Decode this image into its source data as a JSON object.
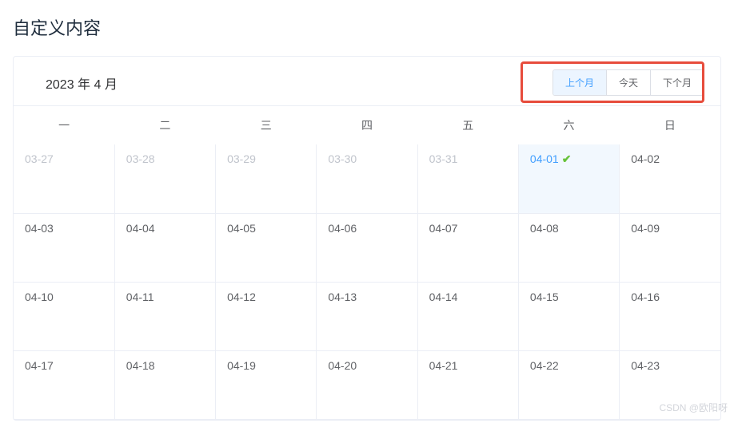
{
  "title": "自定义内容",
  "dateTitle": "2023 年 4 月",
  "buttons": {
    "prev": "上个月",
    "today": "今天",
    "next": "下个月"
  },
  "weekdays": [
    "一",
    "二",
    "三",
    "四",
    "五",
    "六",
    "日"
  ],
  "rows": [
    [
      {
        "label": "03-27",
        "cls": "prev-month"
      },
      {
        "label": "03-28",
        "cls": "prev-month"
      },
      {
        "label": "03-29",
        "cls": "prev-month"
      },
      {
        "label": "03-30",
        "cls": "prev-month"
      },
      {
        "label": "03-31",
        "cls": "prev-month"
      },
      {
        "label": "04-01",
        "cls": "today",
        "check": true
      },
      {
        "label": "04-02",
        "cls": ""
      }
    ],
    [
      {
        "label": "04-03",
        "cls": ""
      },
      {
        "label": "04-04",
        "cls": ""
      },
      {
        "label": "04-05",
        "cls": ""
      },
      {
        "label": "04-06",
        "cls": ""
      },
      {
        "label": "04-07",
        "cls": ""
      },
      {
        "label": "04-08",
        "cls": ""
      },
      {
        "label": "04-09",
        "cls": ""
      }
    ],
    [
      {
        "label": "04-10",
        "cls": ""
      },
      {
        "label": "04-11",
        "cls": ""
      },
      {
        "label": "04-12",
        "cls": ""
      },
      {
        "label": "04-13",
        "cls": ""
      },
      {
        "label": "04-14",
        "cls": ""
      },
      {
        "label": "04-15",
        "cls": ""
      },
      {
        "label": "04-16",
        "cls": ""
      }
    ],
    [
      {
        "label": "04-17",
        "cls": ""
      },
      {
        "label": "04-18",
        "cls": ""
      },
      {
        "label": "04-19",
        "cls": ""
      },
      {
        "label": "04-20",
        "cls": ""
      },
      {
        "label": "04-21",
        "cls": ""
      },
      {
        "label": "04-22",
        "cls": ""
      },
      {
        "label": "04-23",
        "cls": ""
      }
    ]
  ],
  "watermark": "CSDN @欧阳呀"
}
